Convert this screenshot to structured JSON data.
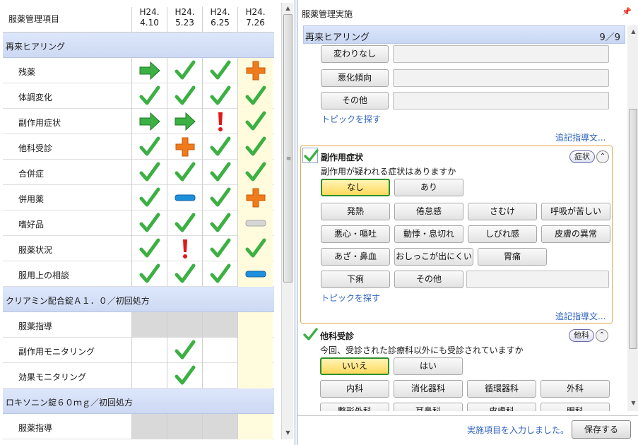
{
  "left": {
    "header_title": "服薬管理項目",
    "dates": [
      {
        "year": "H24.",
        "day": "4.10"
      },
      {
        "year": "H24.",
        "day": "5.23"
      },
      {
        "year": "H24.",
        "day": "6.25"
      },
      {
        "year": "H24.",
        "day": "7.26"
      }
    ],
    "sections": [
      {
        "title": "再来ヒアリング",
        "rows": [
          {
            "label": "残薬",
            "marks": [
              "arrow",
              "check",
              "check",
              "plus"
            ]
          },
          {
            "label": "体調変化",
            "marks": [
              "check",
              "check",
              "check",
              "check"
            ]
          },
          {
            "label": "副作用症状",
            "marks": [
              "arrow",
              "arrow",
              "exclaim",
              "check"
            ]
          },
          {
            "label": "他科受診",
            "marks": [
              "check",
              "plus",
              "check",
              "check"
            ]
          },
          {
            "label": "合併症",
            "marks": [
              "check",
              "check",
              "check",
              "check"
            ]
          },
          {
            "label": "併用薬",
            "marks": [
              "check",
              "bluebar",
              "check",
              "plus"
            ]
          },
          {
            "label": "嗜好品",
            "marks": [
              "check",
              "check",
              "check",
              "greybar"
            ]
          },
          {
            "label": "服薬状況",
            "marks": [
              "check",
              "exclaim",
              "check",
              "check"
            ]
          },
          {
            "label": "服用上の相談",
            "marks": [
              "check",
              "check",
              "check",
              "bluebar"
            ]
          }
        ]
      },
      {
        "title": "クリアミン配合錠Ａ１．０／初回処方",
        "rows": [
          {
            "label": "服薬指導",
            "marks": [
              "grey",
              "grey",
              "grey",
              "none"
            ]
          },
          {
            "label": "副作用モニタリング",
            "marks": [
              "none",
              "check",
              "none",
              "none"
            ]
          },
          {
            "label": "効果モニタリング",
            "marks": [
              "none",
              "check",
              "none",
              "none"
            ]
          }
        ]
      },
      {
        "title": "ロキソニン錠６０ｍｇ／初回処方",
        "rows": [
          {
            "label": "服薬指導",
            "marks": [
              "grey",
              "grey",
              "grey",
              "none"
            ]
          }
        ]
      }
    ]
  },
  "right": {
    "title": "服薬管理実施",
    "pin_icon": "pin-icon",
    "hearing_title": "再来ヒアリング",
    "hearing_count": "9／9",
    "top_buttons": [
      "変わりなし",
      "悪化傾向",
      "その他"
    ],
    "topic_link": "トピックを探す",
    "guidance_link": "追記指導文...",
    "side_effect": {
      "title": "副作用症状",
      "question": "副作用が疑われる症状はありますか",
      "tag": "症状",
      "answers": [
        "なし",
        "あり"
      ],
      "selected": "なし",
      "symptoms": [
        [
          "発熱",
          "倦怠感",
          "さむけ",
          "呼吸が苦しい"
        ],
        [
          "悪心・嘔吐",
          "動悸・息切れ",
          "しびれ感",
          "皮膚の異常"
        ],
        [
          "あざ・鼻血",
          "おしっこが出にくい",
          "胃痛"
        ],
        [
          "下痢",
          "その他"
        ]
      ]
    },
    "other_dept": {
      "title": "他科受診",
      "question": "今回、受診された診療科以外にも受診されていますか",
      "tag": "他科",
      "answers": [
        "いいえ",
        "はい"
      ],
      "selected": "いいえ",
      "depts": [
        [
          "内科",
          "消化器科",
          "循環器科",
          "外科"
        ],
        [
          "整形外科",
          "耳鼻科",
          "皮膚科",
          "眼科"
        ]
      ]
    },
    "footer_message": "実施項目を入力しました。",
    "save_label": "保存する"
  },
  "colors": {
    "check": "#3cb043",
    "arrow": "#3cb043",
    "plus": "#f07b1c",
    "exclaim": "#e01818",
    "bluebar": "#1e8fdc",
    "section_bg": "#d5e0f7",
    "today_bg": "#fffbdc",
    "selected_btn": "#ffd95c",
    "link": "#2e63c0"
  }
}
